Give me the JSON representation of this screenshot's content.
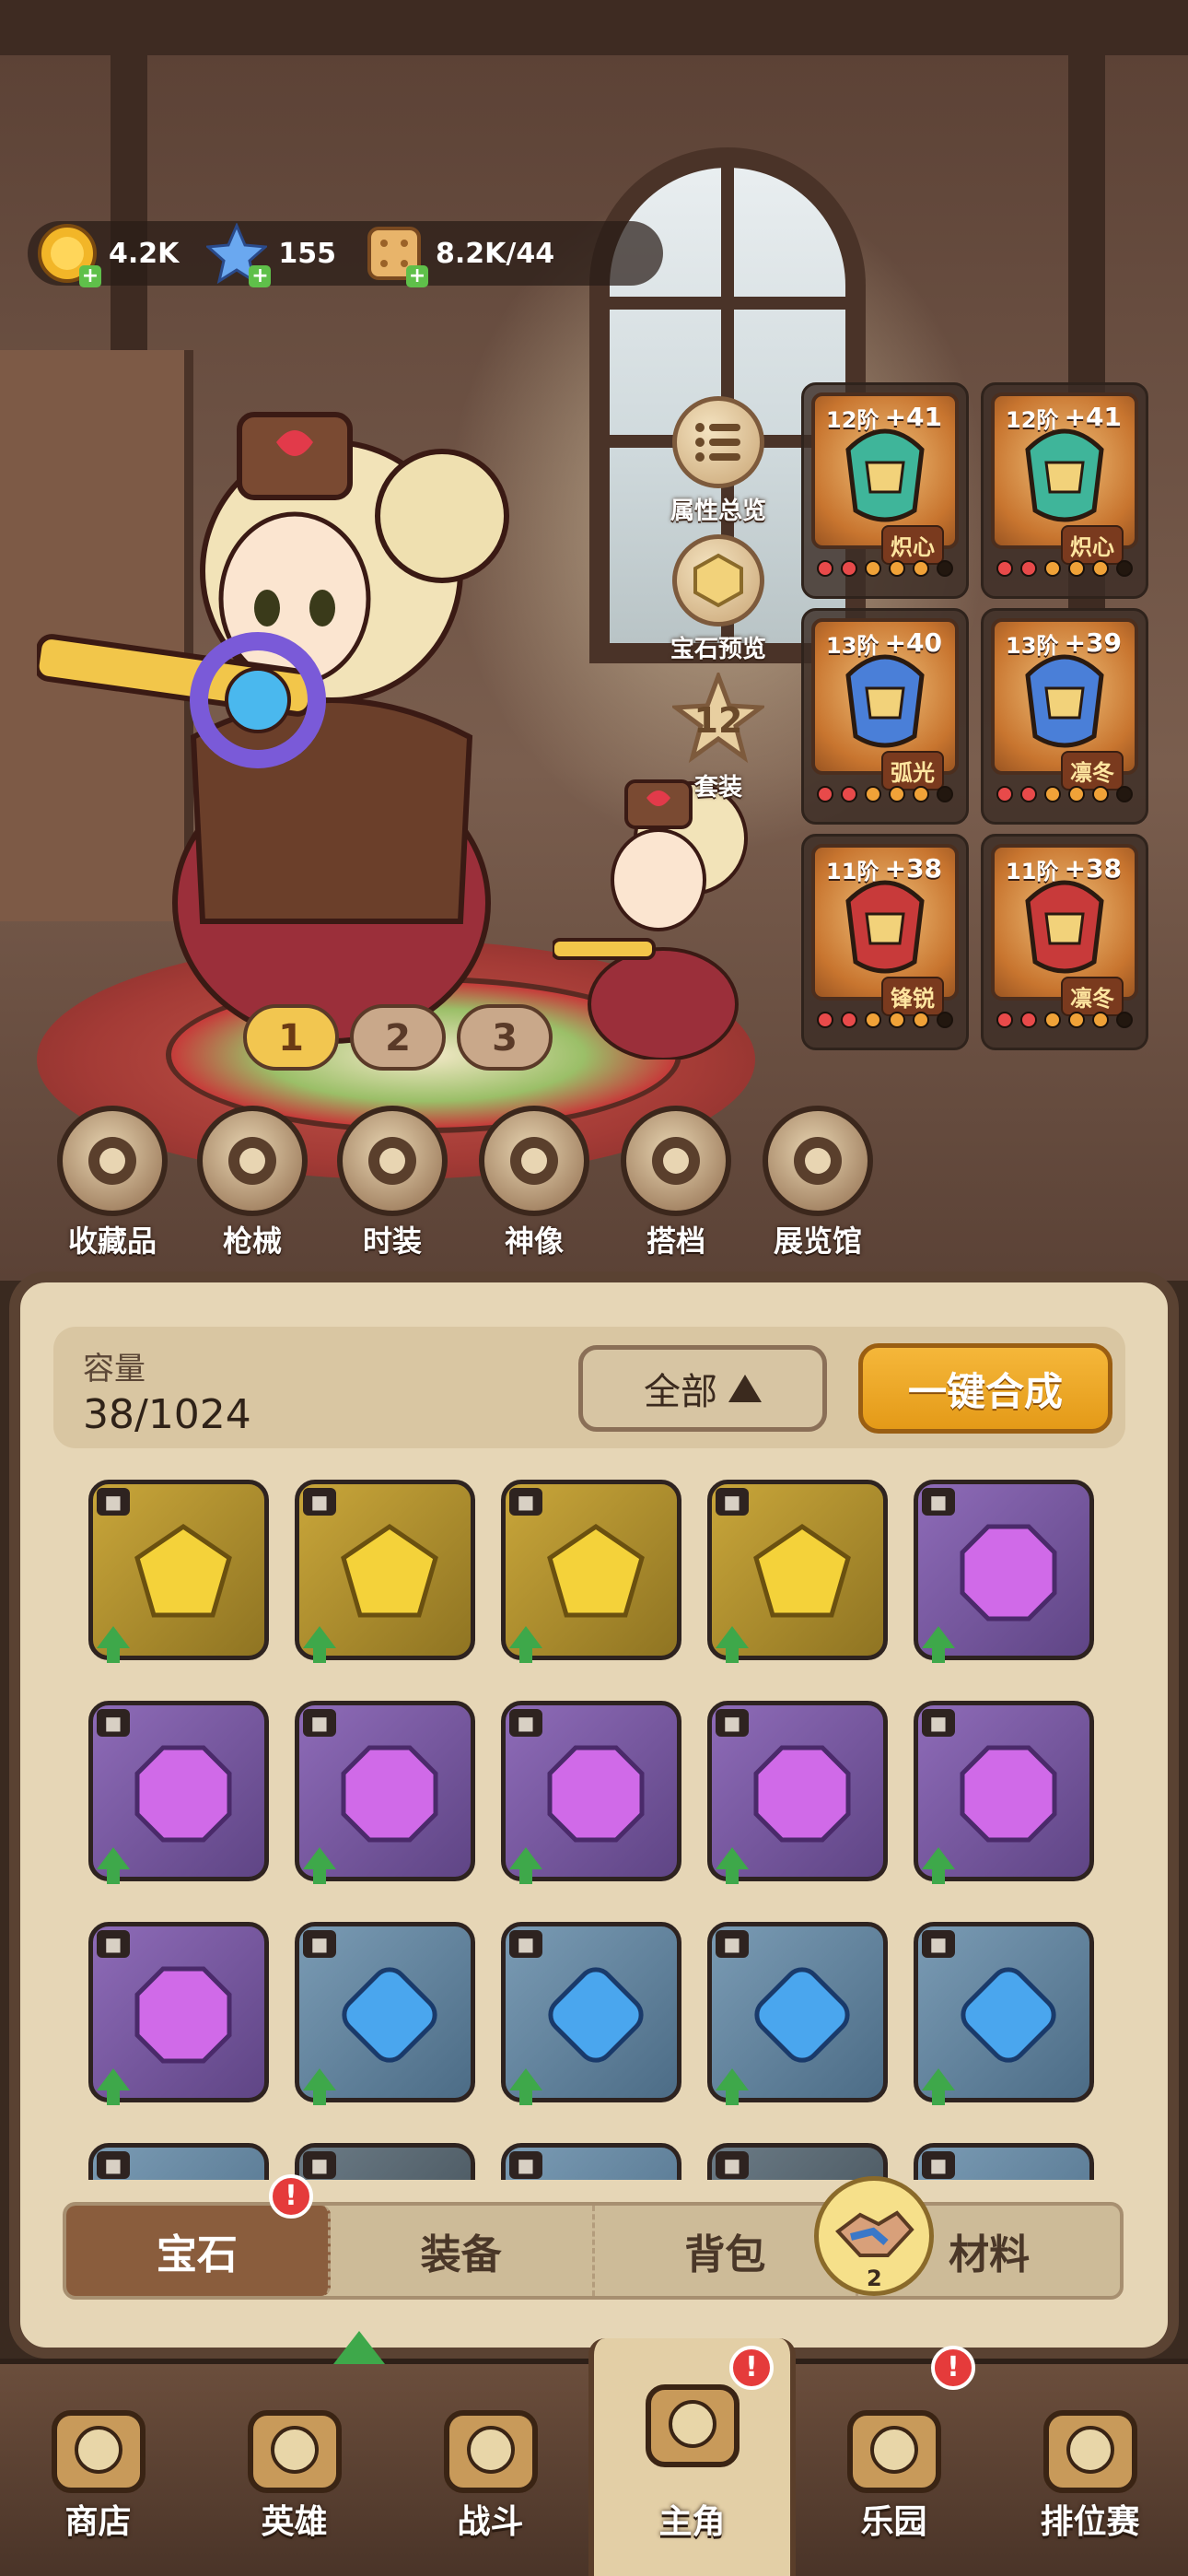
{
  "currency": {
    "coins": "4.2K",
    "stars": "155",
    "biscuit": "8.2K/44"
  },
  "side_buttons": {
    "attributes": "属性总览",
    "gem_preview": "宝石预览",
    "set_count": "12",
    "set_label": "套装"
  },
  "equipment": [
    {
      "tier": "12阶",
      "bonus": "+41",
      "tag": "炽心",
      "color": "#3fb59a"
    },
    {
      "tier": "12阶",
      "bonus": "+41",
      "tag": "炽心",
      "color": "#3fb59a"
    },
    {
      "tier": "13阶",
      "bonus": "+40",
      "tag": "弧光",
      "color": "#4a7fd8"
    },
    {
      "tier": "13阶",
      "bonus": "+39",
      "tag": "凛冬",
      "color": "#4a7fd8"
    },
    {
      "tier": "11阶",
      "bonus": "+38",
      "tag": "锋锐",
      "color": "#c83a3a"
    },
    {
      "tier": "11阶",
      "bonus": "+38",
      "tag": "凛冬",
      "color": "#c83a3a"
    }
  ],
  "pages": [
    "1",
    "2",
    "3"
  ],
  "collections": [
    {
      "label": "收藏品",
      "icon": "collectible-icon"
    },
    {
      "label": "枪械",
      "icon": "gun-icon"
    },
    {
      "label": "时装",
      "icon": "outfit-icon"
    },
    {
      "label": "神像",
      "icon": "statue-icon"
    },
    {
      "label": "搭档",
      "icon": "partner-icon"
    },
    {
      "label": "展览馆",
      "icon": "crown-icon"
    }
  ],
  "inventory": {
    "capacity_label": "容量",
    "capacity_value": "38/1024",
    "filter_label": "全部",
    "merge_label": "一键合成"
  },
  "gem_colors": {
    "gold": "#f4d23a",
    "purple": "#d06ae8",
    "blue": "#4aa6ee"
  },
  "gems": [
    [
      "gold",
      "gold",
      "gold",
      "gold",
      "purple"
    ],
    [
      "purple",
      "purple",
      "purple",
      "purple",
      "purple"
    ],
    [
      "purple",
      "blue",
      "blue",
      "blue",
      "blue"
    ],
    [
      "blue",
      "dark",
      "blue",
      "dark",
      "blue"
    ]
  ],
  "tabs": [
    {
      "label": "宝石",
      "active": true
    },
    {
      "label": "装备",
      "active": false
    },
    {
      "label": "背包",
      "active": false
    },
    {
      "label": "材料",
      "active": false
    }
  ],
  "partner_badge_count": "2",
  "alert_mark": "!",
  "nav": [
    {
      "label": "商店",
      "icon": "shop-icon"
    },
    {
      "label": "英雄",
      "icon": "hero-cards-icon"
    },
    {
      "label": "战斗",
      "icon": "battle-icon"
    },
    {
      "label": "主角",
      "icon": "owl-icon"
    },
    {
      "label": "乐园",
      "icon": "castle-icon"
    },
    {
      "label": "排位赛",
      "icon": "ranked-icon"
    }
  ]
}
